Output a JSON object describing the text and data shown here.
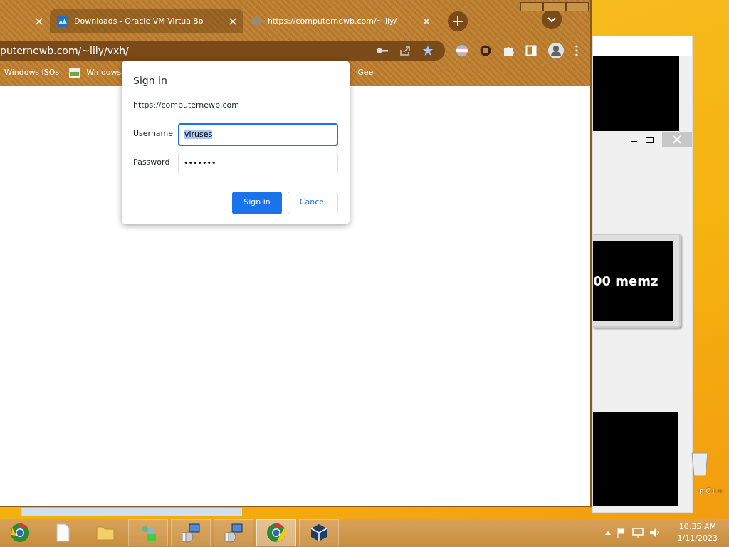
{
  "browser": {
    "tabs": [
      {
        "selected": false
      },
      {
        "title": "Downloads - Oracle VM VirtualBo",
        "selected": true
      },
      {
        "title": "https://computernewb.com/~lily/",
        "selected": false
      }
    ],
    "address": "puternewb.com/~lily/vxh/",
    "bookmarks": [
      "Windows ISOs",
      "Windows",
      "Gee"
    ]
  },
  "dialog": {
    "title": "Sign in",
    "origin": "https://computernewb.com",
    "fields": [
      {
        "label": "Username",
        "value": "viruses",
        "focused": true
      },
      {
        "label": "Password",
        "value": "•••••••",
        "focused": false
      }
    ],
    "buttons": [
      {
        "label": "Sign in",
        "primary": true
      },
      {
        "label": "Cancel",
        "primary": false
      }
    ]
  },
  "background_window": {
    "display_text": "00 memz"
  },
  "desktop": {
    "icon_label": "n C++"
  },
  "taskbar": {
    "apps": [
      {
        "kind": "chrome-dev",
        "selected": false
      },
      {
        "kind": "file",
        "selected": false
      },
      {
        "kind": "folder",
        "selected": false
      },
      {
        "kind": "people",
        "selected": false
      },
      {
        "kind": "setup",
        "selected": false
      },
      {
        "kind": "setup",
        "selected": false
      },
      {
        "kind": "chrome",
        "selected": true
      },
      {
        "kind": "cube",
        "selected": false
      }
    ],
    "time": "10:35 AM",
    "date": "1/11/2023"
  }
}
